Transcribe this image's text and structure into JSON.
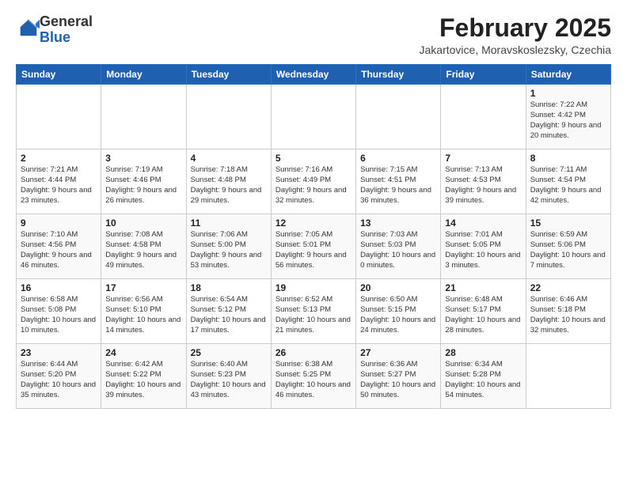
{
  "logo": {
    "general": "General",
    "blue": "Blue"
  },
  "header": {
    "month": "February 2025",
    "location": "Jakartovice, Moravskoslezsky, Czechia"
  },
  "weekdays": [
    "Sunday",
    "Monday",
    "Tuesday",
    "Wednesday",
    "Thursday",
    "Friday",
    "Saturday"
  ],
  "weeks": [
    [
      {
        "day": "",
        "info": ""
      },
      {
        "day": "",
        "info": ""
      },
      {
        "day": "",
        "info": ""
      },
      {
        "day": "",
        "info": ""
      },
      {
        "day": "",
        "info": ""
      },
      {
        "day": "",
        "info": ""
      },
      {
        "day": "1",
        "info": "Sunrise: 7:22 AM\nSunset: 4:42 PM\nDaylight: 9 hours and 20 minutes."
      }
    ],
    [
      {
        "day": "2",
        "info": "Sunrise: 7:21 AM\nSunset: 4:44 PM\nDaylight: 9 hours and 23 minutes."
      },
      {
        "day": "3",
        "info": "Sunrise: 7:19 AM\nSunset: 4:46 PM\nDaylight: 9 hours and 26 minutes."
      },
      {
        "day": "4",
        "info": "Sunrise: 7:18 AM\nSunset: 4:48 PM\nDaylight: 9 hours and 29 minutes."
      },
      {
        "day": "5",
        "info": "Sunrise: 7:16 AM\nSunset: 4:49 PM\nDaylight: 9 hours and 32 minutes."
      },
      {
        "day": "6",
        "info": "Sunrise: 7:15 AM\nSunset: 4:51 PM\nDaylight: 9 hours and 36 minutes."
      },
      {
        "day": "7",
        "info": "Sunrise: 7:13 AM\nSunset: 4:53 PM\nDaylight: 9 hours and 39 minutes."
      },
      {
        "day": "8",
        "info": "Sunrise: 7:11 AM\nSunset: 4:54 PM\nDaylight: 9 hours and 42 minutes."
      }
    ],
    [
      {
        "day": "9",
        "info": "Sunrise: 7:10 AM\nSunset: 4:56 PM\nDaylight: 9 hours and 46 minutes."
      },
      {
        "day": "10",
        "info": "Sunrise: 7:08 AM\nSunset: 4:58 PM\nDaylight: 9 hours and 49 minutes."
      },
      {
        "day": "11",
        "info": "Sunrise: 7:06 AM\nSunset: 5:00 PM\nDaylight: 9 hours and 53 minutes."
      },
      {
        "day": "12",
        "info": "Sunrise: 7:05 AM\nSunset: 5:01 PM\nDaylight: 9 hours and 56 minutes."
      },
      {
        "day": "13",
        "info": "Sunrise: 7:03 AM\nSunset: 5:03 PM\nDaylight: 10 hours and 0 minutes."
      },
      {
        "day": "14",
        "info": "Sunrise: 7:01 AM\nSunset: 5:05 PM\nDaylight: 10 hours and 3 minutes."
      },
      {
        "day": "15",
        "info": "Sunrise: 6:59 AM\nSunset: 5:06 PM\nDaylight: 10 hours and 7 minutes."
      }
    ],
    [
      {
        "day": "16",
        "info": "Sunrise: 6:58 AM\nSunset: 5:08 PM\nDaylight: 10 hours and 10 minutes."
      },
      {
        "day": "17",
        "info": "Sunrise: 6:56 AM\nSunset: 5:10 PM\nDaylight: 10 hours and 14 minutes."
      },
      {
        "day": "18",
        "info": "Sunrise: 6:54 AM\nSunset: 5:12 PM\nDaylight: 10 hours and 17 minutes."
      },
      {
        "day": "19",
        "info": "Sunrise: 6:52 AM\nSunset: 5:13 PM\nDaylight: 10 hours and 21 minutes."
      },
      {
        "day": "20",
        "info": "Sunrise: 6:50 AM\nSunset: 5:15 PM\nDaylight: 10 hours and 24 minutes."
      },
      {
        "day": "21",
        "info": "Sunrise: 6:48 AM\nSunset: 5:17 PM\nDaylight: 10 hours and 28 minutes."
      },
      {
        "day": "22",
        "info": "Sunrise: 6:46 AM\nSunset: 5:18 PM\nDaylight: 10 hours and 32 minutes."
      }
    ],
    [
      {
        "day": "23",
        "info": "Sunrise: 6:44 AM\nSunset: 5:20 PM\nDaylight: 10 hours and 35 minutes."
      },
      {
        "day": "24",
        "info": "Sunrise: 6:42 AM\nSunset: 5:22 PM\nDaylight: 10 hours and 39 minutes."
      },
      {
        "day": "25",
        "info": "Sunrise: 6:40 AM\nSunset: 5:23 PM\nDaylight: 10 hours and 43 minutes."
      },
      {
        "day": "26",
        "info": "Sunrise: 6:38 AM\nSunset: 5:25 PM\nDaylight: 10 hours and 46 minutes."
      },
      {
        "day": "27",
        "info": "Sunrise: 6:36 AM\nSunset: 5:27 PM\nDaylight: 10 hours and 50 minutes."
      },
      {
        "day": "28",
        "info": "Sunrise: 6:34 AM\nSunset: 5:28 PM\nDaylight: 10 hours and 54 minutes."
      },
      {
        "day": "",
        "info": ""
      }
    ]
  ]
}
